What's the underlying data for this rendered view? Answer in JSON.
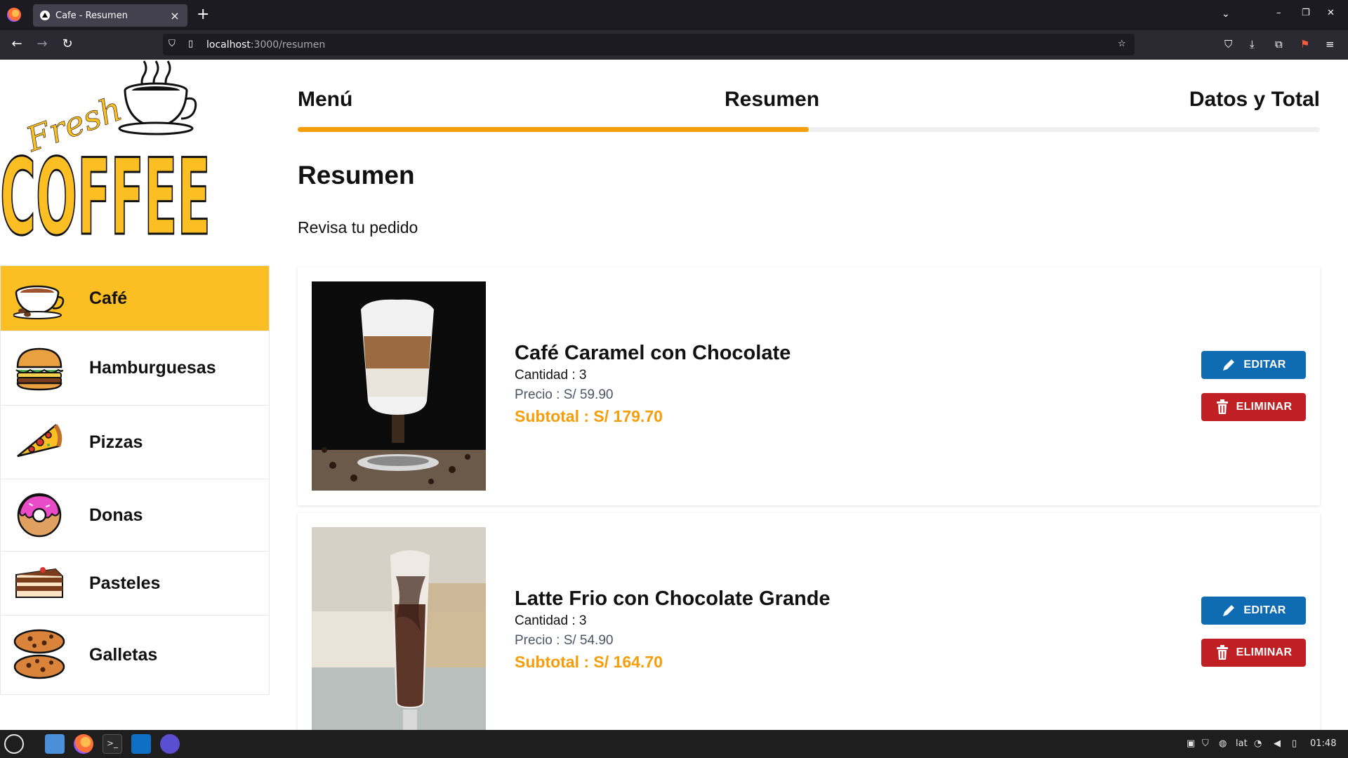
{
  "browser": {
    "tab_title": "Cafe - Resumen",
    "url_host": "localhost",
    "url_path": ":3000/resumen"
  },
  "logo": {
    "line1": "Fresh",
    "line2": "COFFEE"
  },
  "sidebar": {
    "items": [
      {
        "label": "Café",
        "icon": "coffee-cup-icon",
        "active": true
      },
      {
        "label": "Hamburguesas",
        "icon": "burger-icon",
        "active": false
      },
      {
        "label": "Pizzas",
        "icon": "pizza-icon",
        "active": false
      },
      {
        "label": "Donas",
        "icon": "donut-icon",
        "active": false
      },
      {
        "label": "Pasteles",
        "icon": "cake-icon",
        "active": false
      },
      {
        "label": "Galletas",
        "icon": "cookie-icon",
        "active": false
      }
    ]
  },
  "steps": {
    "items": [
      "Menú",
      "Resumen",
      "Datos y Total"
    ],
    "progress": 0.5
  },
  "content": {
    "title": "Resumen",
    "subtitle": "Revisa tu pedido"
  },
  "orders": [
    {
      "name": "Café Caramel con Chocolate",
      "quantity": "Cantidad : 3",
      "price": "Precio : S/ 59.90",
      "subtotal": "Subtotal : S/ 179.70",
      "edit_label": "EDITAR",
      "delete_label": "ELIMINAR"
    },
    {
      "name": "Latte Frio con Chocolate Grande",
      "quantity": "Cantidad : 3",
      "price": "Precio : S/ 54.90",
      "subtotal": "Subtotal : S/ 164.70",
      "edit_label": "EDITAR",
      "delete_label": "ELIMINAR"
    }
  ],
  "taskbar": {
    "keyboard_layout": "lat",
    "clock": "01:48"
  },
  "colors": {
    "accent": "#fbbf24",
    "progress": "#f59e0b",
    "subtotal": "#f59e0b",
    "edit": "#0f6cb3",
    "delete": "#c01f24"
  }
}
